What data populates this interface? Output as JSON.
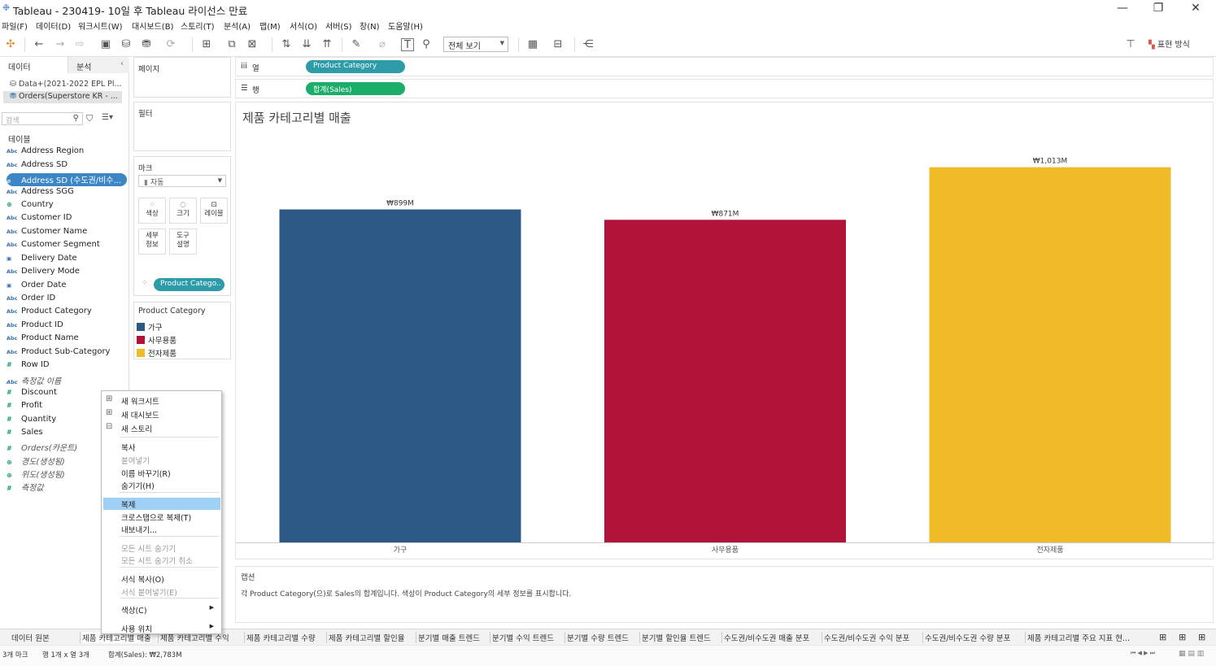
{
  "window": {
    "title": "Tableau - 230419- 10일 후 Tableau 라이선스 만료"
  },
  "menu": [
    "파일(F)",
    "데이터(D)",
    "워크시트(W)",
    "대시보드(B)",
    "스토리(T)",
    "분석(A)",
    "맵(M)",
    "서식(O)",
    "서버(S)",
    "창(N)",
    "도움말(H)"
  ],
  "toolbar": {
    "fit_value": "전체 보기",
    "show_me": "표현 방식"
  },
  "data_pane": {
    "tab_data": "데이터",
    "tab_analysis": "분석",
    "sources": [
      "Data+(2021-2022 EPL Pl...",
      "Orders(Superstore KR - ..."
    ],
    "search_placeholder": "검색",
    "table_header": "테이블",
    "fields": [
      {
        "icon": "Abc",
        "name": "Address Region"
      },
      {
        "icon": "Abc",
        "name": "Address SD"
      },
      {
        "icon": "clip",
        "name": "Address SD (수도권/비수..."
      },
      {
        "icon": "Abc",
        "name": "Address SGG"
      },
      {
        "icon": "globe",
        "name": "Country"
      },
      {
        "icon": "Abc",
        "name": "Customer ID"
      },
      {
        "icon": "Abc",
        "name": "Customer Name"
      },
      {
        "icon": "Abc",
        "name": "Customer Segment"
      },
      {
        "icon": "cal",
        "name": "Delivery Date"
      },
      {
        "icon": "Abc",
        "name": "Delivery Mode"
      },
      {
        "icon": "cal",
        "name": "Order Date"
      },
      {
        "icon": "Abc",
        "name": "Order ID"
      },
      {
        "icon": "Abc",
        "name": "Product Category"
      },
      {
        "icon": "Abc",
        "name": "Product ID"
      },
      {
        "icon": "Abc",
        "name": "Product Name"
      },
      {
        "icon": "Abc",
        "name": "Product Sub-Category"
      },
      {
        "icon": "#",
        "name": "Row ID"
      },
      {
        "icon": "Abc",
        "name": "측정값 이름"
      },
      {
        "icon": "#",
        "name": "Discount"
      },
      {
        "icon": "#",
        "name": "Profit"
      },
      {
        "icon": "#",
        "name": "Quantity"
      },
      {
        "icon": "#",
        "name": "Sales"
      },
      {
        "icon": "#",
        "name": "Orders(카운트)"
      },
      {
        "icon": "globe",
        "name": "경도(생성됨)"
      },
      {
        "icon": "globe",
        "name": "위도(생성됨)"
      },
      {
        "icon": "#",
        "name": "측정값"
      }
    ]
  },
  "shelves": {
    "pages": "페이지",
    "filters": "필터",
    "marks": "마크",
    "mark_type": "자동",
    "mark_buttons": [
      "색상",
      "크기",
      "레이블",
      "세부\n정보",
      "도구\n설명"
    ],
    "mark_pill": "Product Catego..",
    "legend_title": "Product Category",
    "columns_label": "열",
    "rows_label": "행",
    "columns_pill": "Product Category",
    "rows_pill": "합계(Sales)"
  },
  "chart_data": {
    "type": "bar",
    "title": "제품 카테고리별 매출",
    "categories": [
      "가구",
      "사무용품",
      "전자제품"
    ],
    "values": [
      899,
      871,
      1013
    ],
    "labels": [
      "₩899M",
      "₩871M",
      "₩1,013M"
    ],
    "colors": [
      "#2c5886",
      "#b01238",
      "#efbc27"
    ],
    "ylim": [
      0,
      1100
    ],
    "grid": false
  },
  "caption": {
    "header": "캡션",
    "text": "각 Product Category(으)로 Sales의 합계입니다. 색상이 Product Category의 세부 정보를 표시합니다."
  },
  "context_menu": [
    {
      "label": "새 워크시트",
      "state": "normal"
    },
    {
      "label": "새 대시보드",
      "state": "normal"
    },
    {
      "label": "새 스토리",
      "state": "normal"
    },
    {
      "label": "복사",
      "state": "normal"
    },
    {
      "label": "붙여넣기",
      "state": "disabled"
    },
    {
      "label": "이름 바꾸기(R)",
      "state": "normal"
    },
    {
      "label": "숨기기(H)",
      "state": "normal"
    },
    {
      "label": "복제",
      "state": "highlighted"
    },
    {
      "label": "크로스탭으로 복제(T)",
      "state": "normal"
    },
    {
      "label": "내보내기...",
      "state": "normal"
    },
    {
      "label": "모든 시트 숨기기",
      "state": "disabled"
    },
    {
      "label": "모든 시트 숨기기 취소",
      "state": "disabled"
    },
    {
      "label": "서식 복사(O)",
      "state": "normal"
    },
    {
      "label": "서식 붙여넣기(E)",
      "state": "disabled"
    },
    {
      "label": "색상(C)",
      "state": "normal"
    },
    {
      "label": "사용 위치",
      "state": "normal"
    }
  ],
  "tabs": [
    "데이터 원본",
    "제품 카테고리별 매출",
    "제품 카테고리별 수익",
    "제품 카테고리별 수량",
    "제품 카테고리별 할인율",
    "분기별 매출 트렌드",
    "분기별 수익 트렌드",
    "분기별 수량 트렌드",
    "분기별 할인율 트렌드",
    "수도권/비수도권 매출 분포",
    "수도권/비수도권 수익 분포",
    "수도권/비수도권 수량 분포",
    "제품 카테고리별 주요 지표 현..."
  ],
  "status": {
    "marks": "3개 마크",
    "dims": "행 1개 x 열 3개",
    "sum": "합계(Sales): ₩2,783M"
  }
}
